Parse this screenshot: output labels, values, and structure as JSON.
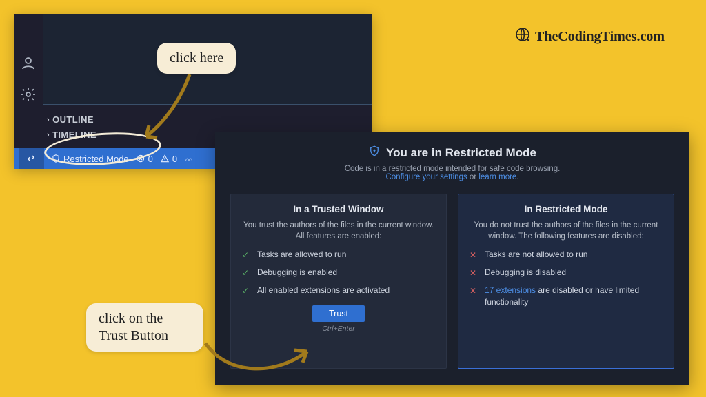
{
  "brand": {
    "text": "TheCodingTimes.com"
  },
  "annotations": {
    "bubble1": "click here",
    "bubble2": "click on the Trust Button"
  },
  "panel1": {
    "outline": "OUTLINE",
    "timeline": "TIMELINE",
    "restricted": "Restricted Mode",
    "errors": "0",
    "warnings": "0"
  },
  "dialog": {
    "title": "You are in Restricted Mode",
    "sub_prefix": "Code is in a restricted mode intended for safe code browsing.",
    "sub_link1": "Configure your settings",
    "sub_or": " or ",
    "sub_link2": "learn more",
    "sub_period": ".",
    "trusted": {
      "title": "In a Trusted Window",
      "lead": "You trust the authors of the files in the current window. All features are enabled:",
      "items": [
        "Tasks are allowed to run",
        "Debugging is enabled",
        "All enabled extensions are activated"
      ],
      "button": "Trust",
      "hint": "Ctrl+Enter"
    },
    "restricted": {
      "title": "In Restricted Mode",
      "lead": "You do not trust the authors of the files in the current window. The following features are disabled:",
      "items": [
        "Tasks are not allowed to run",
        "Debugging is disabled"
      ],
      "ext_link": "17 extensions",
      "ext_tail": " are disabled or have limited functionality"
    }
  }
}
